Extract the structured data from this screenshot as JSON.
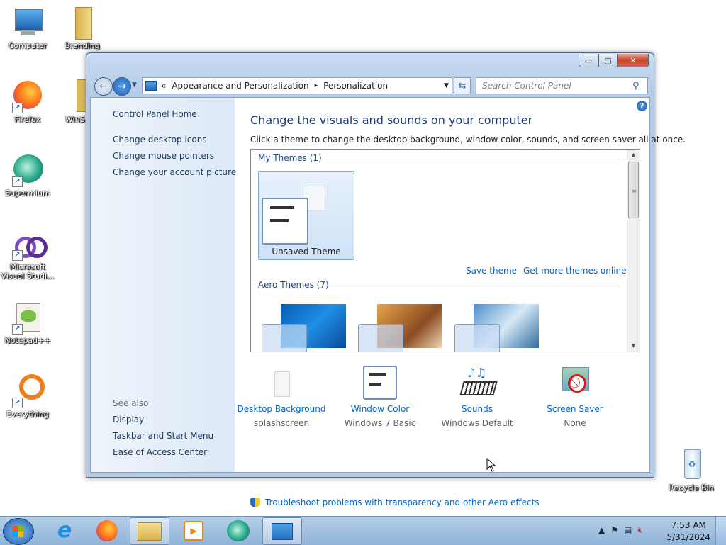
{
  "desktop": {
    "icons": [
      {
        "label": "Computer"
      },
      {
        "label": "Branding"
      },
      {
        "label": "Firefox"
      },
      {
        "label": "WinS..."
      },
      {
        "label": "Supermium"
      },
      {
        "label": "Microsoft Visual Studi..."
      },
      {
        "label": "Notepad++"
      },
      {
        "label": "Everything"
      },
      {
        "label": "Recycle Bin"
      }
    ]
  },
  "window": {
    "caption_buttons": {
      "minimize": "▭",
      "maximize": "▢",
      "close": "✕"
    },
    "breadcrumb": {
      "chevron": "«",
      "segments": [
        "Appearance and Personalization",
        "Personalization"
      ],
      "separator": "▸"
    },
    "search": {
      "placeholder": "Search Control Panel"
    },
    "left_pane": {
      "home": "Control Panel Home",
      "links": [
        "Change desktop icons",
        "Change mouse pointers",
        "Change your account picture"
      ],
      "see_also_title": "See also",
      "see_also": [
        "Display",
        "Taskbar and Start Menu",
        "Ease of Access Center"
      ]
    },
    "main": {
      "heading": "Change the visuals and sounds on your computer",
      "subheading": "Click a theme to change the desktop background, window color, sounds, and screen saver all at once.",
      "my_themes_header": "My Themes (1)",
      "unsaved_theme": "Unsaved Theme",
      "save_theme": "Save theme",
      "get_more_themes": "Get more themes online",
      "aero_themes_header": "Aero Themes (7)",
      "settings": [
        {
          "title": "Desktop Background",
          "value": "splashscreen"
        },
        {
          "title": "Window Color",
          "value": "Windows 7 Basic"
        },
        {
          "title": "Sounds",
          "value": "Windows Default"
        },
        {
          "title": "Screen Saver",
          "value": "None"
        }
      ],
      "troubleshoot": "Troubleshoot problems with transparency and other Aero effects"
    }
  },
  "taskbar": {
    "time": "7:53 AM",
    "date": "5/31/2024"
  },
  "colors": {
    "link": "#0066cc",
    "heading": "#1e3d6e",
    "pane_link": "#1e395b"
  }
}
